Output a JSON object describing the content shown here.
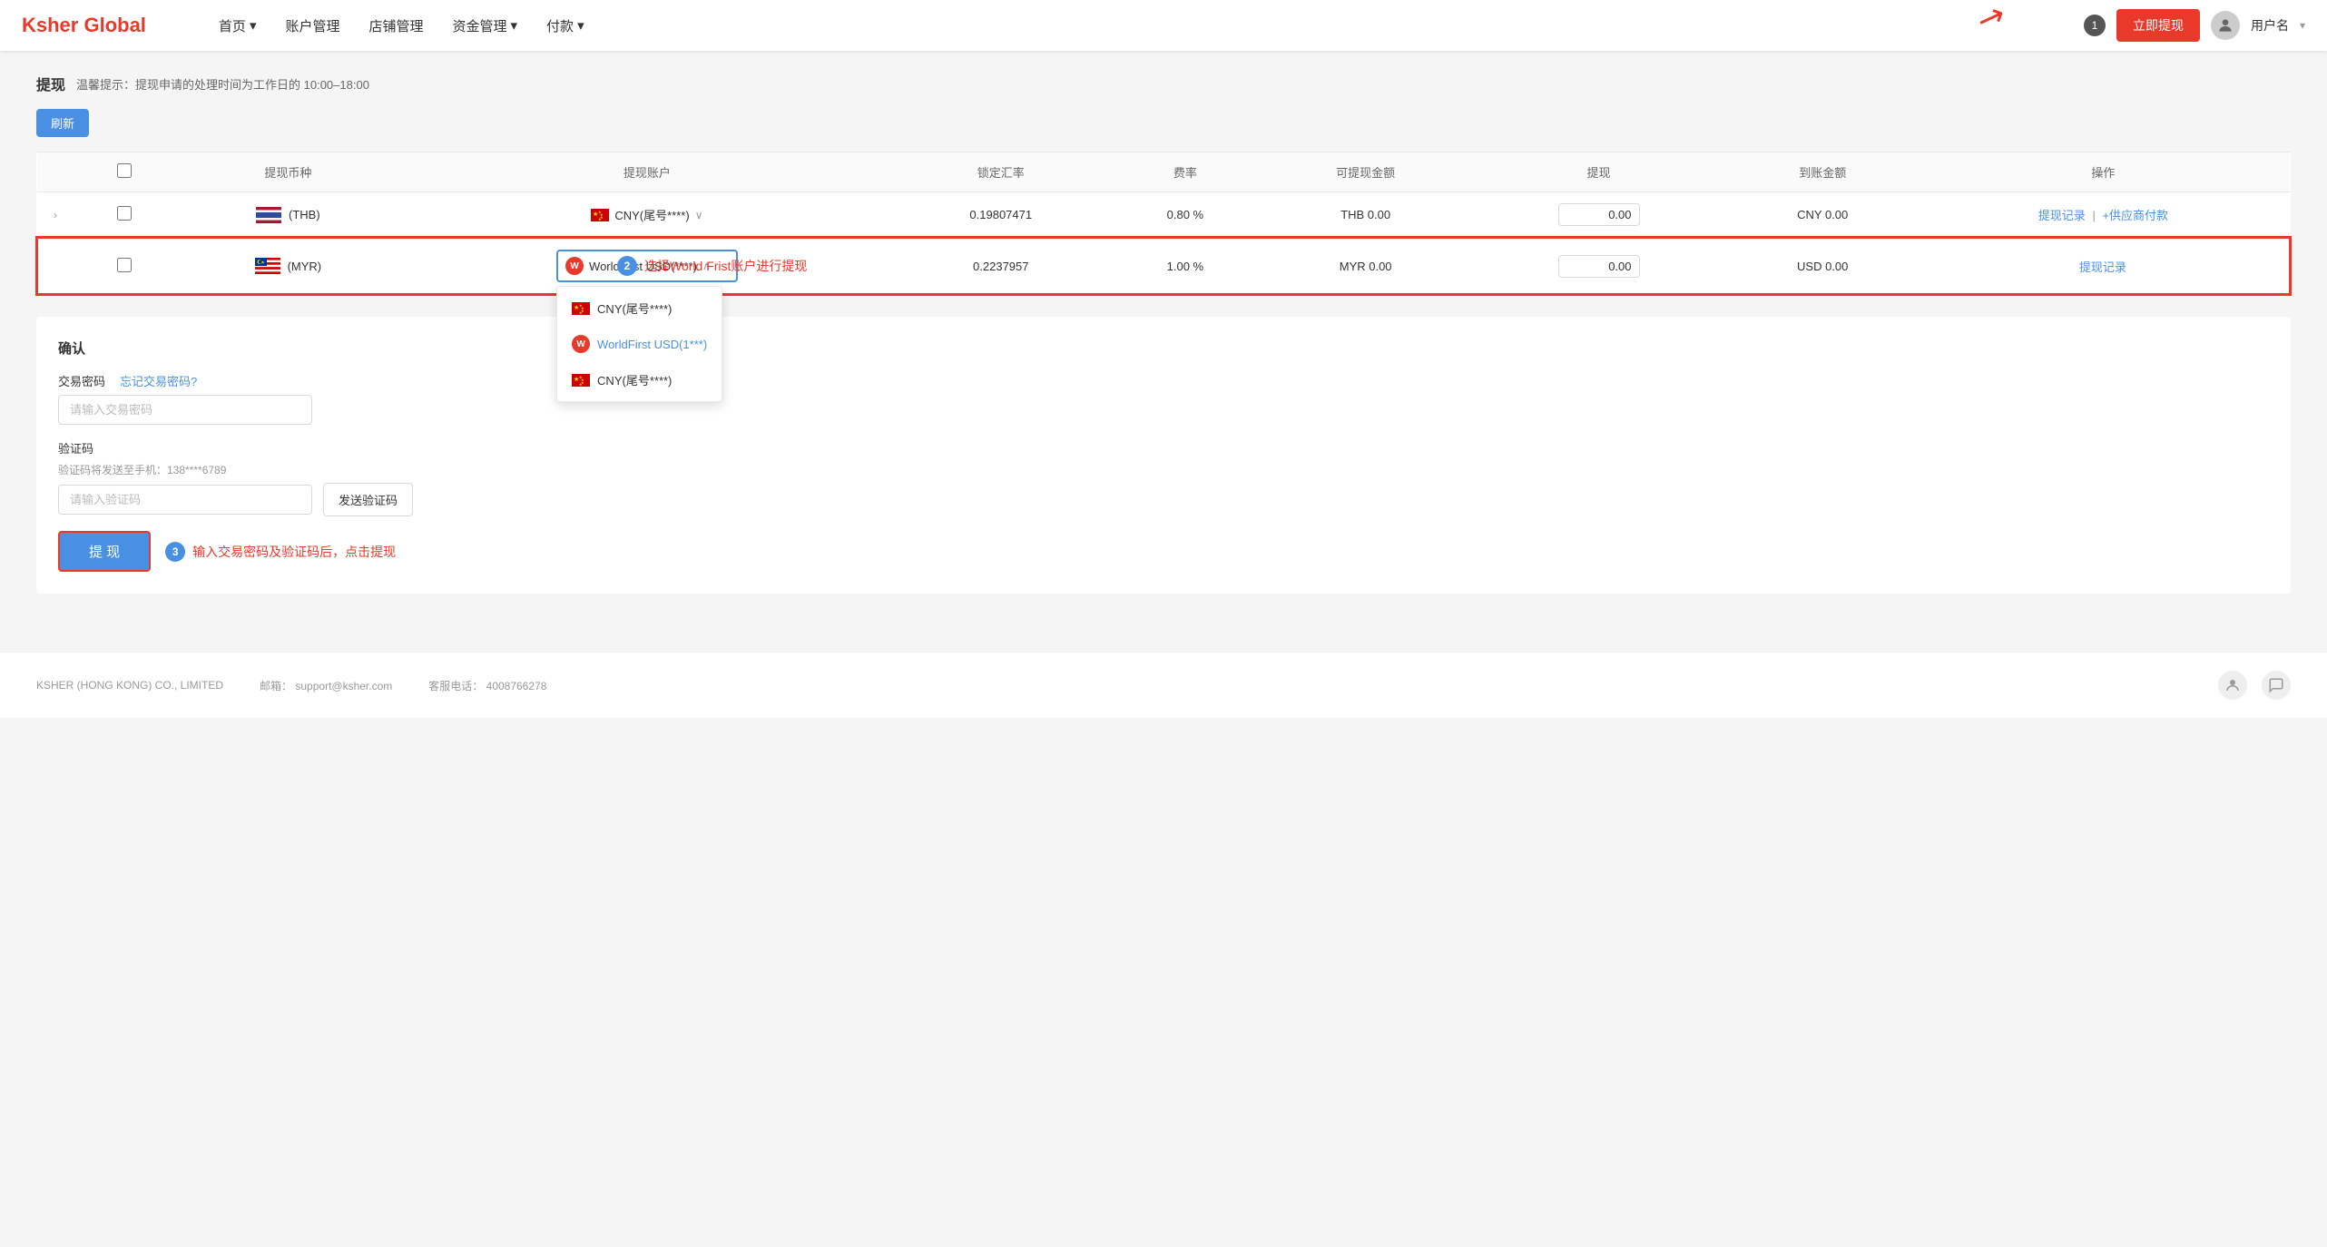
{
  "header": {
    "logo": "Ksher Global",
    "nav": [
      {
        "label": "首页",
        "hasDropdown": true
      },
      {
        "label": "账户管理",
        "hasDropdown": false
      },
      {
        "label": "店铺管理",
        "hasDropdown": false
      },
      {
        "label": "资金管理",
        "hasDropdown": true
      },
      {
        "label": "付款",
        "hasDropdown": true
      }
    ],
    "notification_count": "1",
    "withdraw_btn": "立即提现",
    "user_name": "用户名"
  },
  "page": {
    "title": "提现",
    "notice": "温馨提示：提现申请的处理时间为工作日的 10:00–18:00",
    "refresh_btn": "刷新",
    "table": {
      "columns": [
        "",
        "",
        "提现币种",
        "提现账户",
        "锁定汇率",
        "费率",
        "可提现金额",
        "提现",
        "到账金额",
        "操作"
      ],
      "rows": [
        {
          "expand": true,
          "checked": false,
          "currency_flag": "th",
          "currency_code": "THB",
          "account": "CNY(尾号****)",
          "exchange_rate": "0.19807471",
          "fee_rate": "0.80 %",
          "available": "THB 0.00",
          "withdraw_amount": "0.00",
          "arrival": "CNY 0.00",
          "actions": [
            "提现记录",
            "+供应商付款"
          ]
        },
        {
          "expand": false,
          "checked": false,
          "currency_flag": "my",
          "currency_code": "MYR",
          "account": "WorldFirst USD(****)",
          "exchange_rate": "0.2237957",
          "fee_rate": "1.00 %",
          "available": "MYR 0.00",
          "withdraw_amount": "0.00",
          "arrival": "USD 0.00",
          "actions": [
            "提现记录"
          ],
          "highlighted": true
        }
      ]
    },
    "dropdown": {
      "items": [
        {
          "type": "cn_flag",
          "label": "CNY(尾号****)"
        },
        {
          "type": "wf",
          "label": "WorldFirst USD(1***)",
          "selected": true
        },
        {
          "type": "cn_flag",
          "label": "CNY(尾号****)"
        }
      ]
    },
    "annotation2": {
      "bubble": "2",
      "text": "选择World Frist账户进行提现"
    }
  },
  "confirm": {
    "title": "确认",
    "password_label": "交易密码",
    "password_placeholder": "请输入交易密码",
    "forgot_link": "忘记交易密码?",
    "code_label": "验证码",
    "phone_hint": "验证码将发送至手机：138****6789",
    "code_placeholder": "请输入验证码",
    "send_code_btn": "发送验证码",
    "withdraw_btn": "提 现",
    "annotation3": {
      "bubble": "3",
      "text": "输入交易密码及验证码后，点击提现"
    }
  },
  "footer": {
    "company": "KSHER (HONG KONG) CO., LIMITED",
    "email_label": "邮箱：",
    "email": "support@ksher.com",
    "phone_label": "客服电话：",
    "phone": "4008766278"
  }
}
